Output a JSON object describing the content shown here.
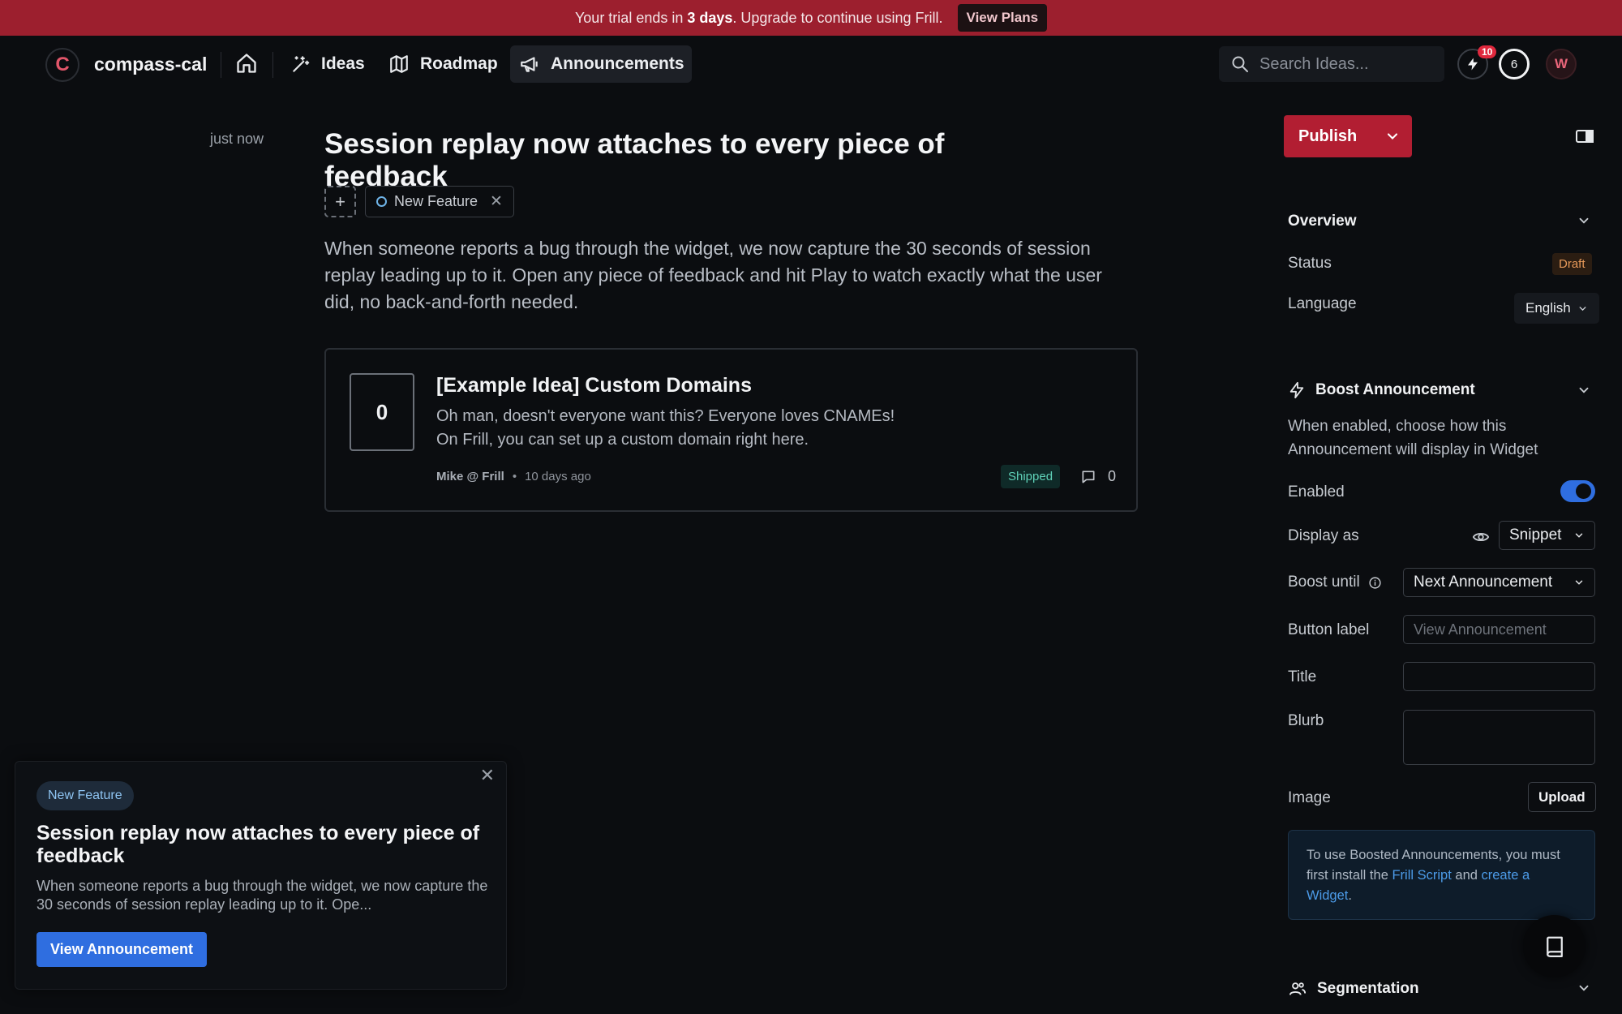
{
  "banner": {
    "text_before": "Your trial ends in ",
    "days": "3 days",
    "text_after": ". Upgrade to continue using Frill.",
    "button": "View Plans"
  },
  "nav": {
    "logo_letter": "C",
    "brand": "compass-cal",
    "items": [
      {
        "label": "Ideas",
        "icon": "magic-wand-icon"
      },
      {
        "label": "Roadmap",
        "icon": "map-icon"
      },
      {
        "label": "Announcements",
        "icon": "megaphone-icon"
      }
    ],
    "search_placeholder": "Search Ideas...",
    "notification_count": "10",
    "ideas_count": "6",
    "avatar_letter": "W"
  },
  "post": {
    "timestamp": "just now",
    "title": "Session replay now attaches to every piece of feedback",
    "tag": "New Feature",
    "body": "When someone reports a bug through the widget, we now capture the 30 seconds of session replay leading up to it. Open any piece of feedback and hit Play to watch exactly what the user did, no back-and-forth needed."
  },
  "idea_card": {
    "votes": "0",
    "title": "[Example Idea] Custom Domains",
    "desc_line1": "Oh man, doesn't everyone want this? Everyone loves CNAMEs!",
    "desc_line2": "On Frill, you can set up a custom domain right here.",
    "author": "Mike @ Frill",
    "time": "10 days ago",
    "status": "Shipped",
    "comments": "0"
  },
  "preview": {
    "tag": "New Feature",
    "title": "Session replay now attaches to every piece of feedback",
    "blurb": "When someone reports a bug through the widget, we now capture the 30 seconds of session replay leading up to it. Ope...",
    "button": "View Announcement"
  },
  "sidebar": {
    "publish": "Publish",
    "overview": {
      "title": "Overview",
      "status_label": "Status",
      "status_value": "Draft",
      "language_label": "Language",
      "language_value": "English"
    },
    "boost": {
      "title": "Boost Announcement",
      "description": "When enabled, choose how this Announcement will display in Widget",
      "enabled_label": "Enabled",
      "enabled": true,
      "display_as_label": "Display as",
      "display_as_value": "Snippet",
      "boost_until_label": "Boost until",
      "boost_until_value": "Next Announcement",
      "button_label_label": "Button label",
      "button_label_placeholder": "View Announcement",
      "title_label": "Title",
      "title_value": "",
      "blurb_label": "Blurb",
      "blurb_value": "",
      "image_label": "Image",
      "upload": "Upload",
      "info_pre": "To use Boosted Announcements, you must first install the ",
      "info_link1": "Frill Script",
      "info_mid": " and ",
      "info_link2": "create a Widget",
      "info_post": "."
    },
    "segmentation": {
      "title": "Segmentation"
    }
  },
  "colors": {
    "banner": "#9c1f2e",
    "publish": "#b21e32",
    "accent_blue": "#2f6ee0",
    "background": "#0b0d10"
  }
}
